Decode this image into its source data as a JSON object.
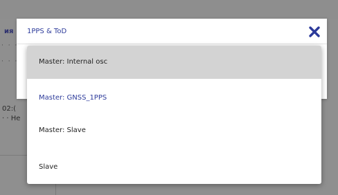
{
  "background": {
    "left_heading_fragment": "ия",
    "left_dots_1": "· · · ·",
    "left_dots_2": "· · · ·",
    "left_value_1": "02:(",
    "left_value_2": "· · Не"
  },
  "modal": {
    "title": "1PPS & ToD",
    "close_icon": "close-x-icon",
    "accent_color": "#2c3a9a"
  },
  "dropdown": {
    "options": [
      {
        "label": "Master: Internal osc",
        "state": "selected"
      },
      {
        "label": "Master: GNSS_1PPS",
        "state": "highlighted"
      },
      {
        "label": "Master: Slave",
        "state": "normal"
      },
      {
        "label": "Slave",
        "state": "normal"
      }
    ]
  }
}
